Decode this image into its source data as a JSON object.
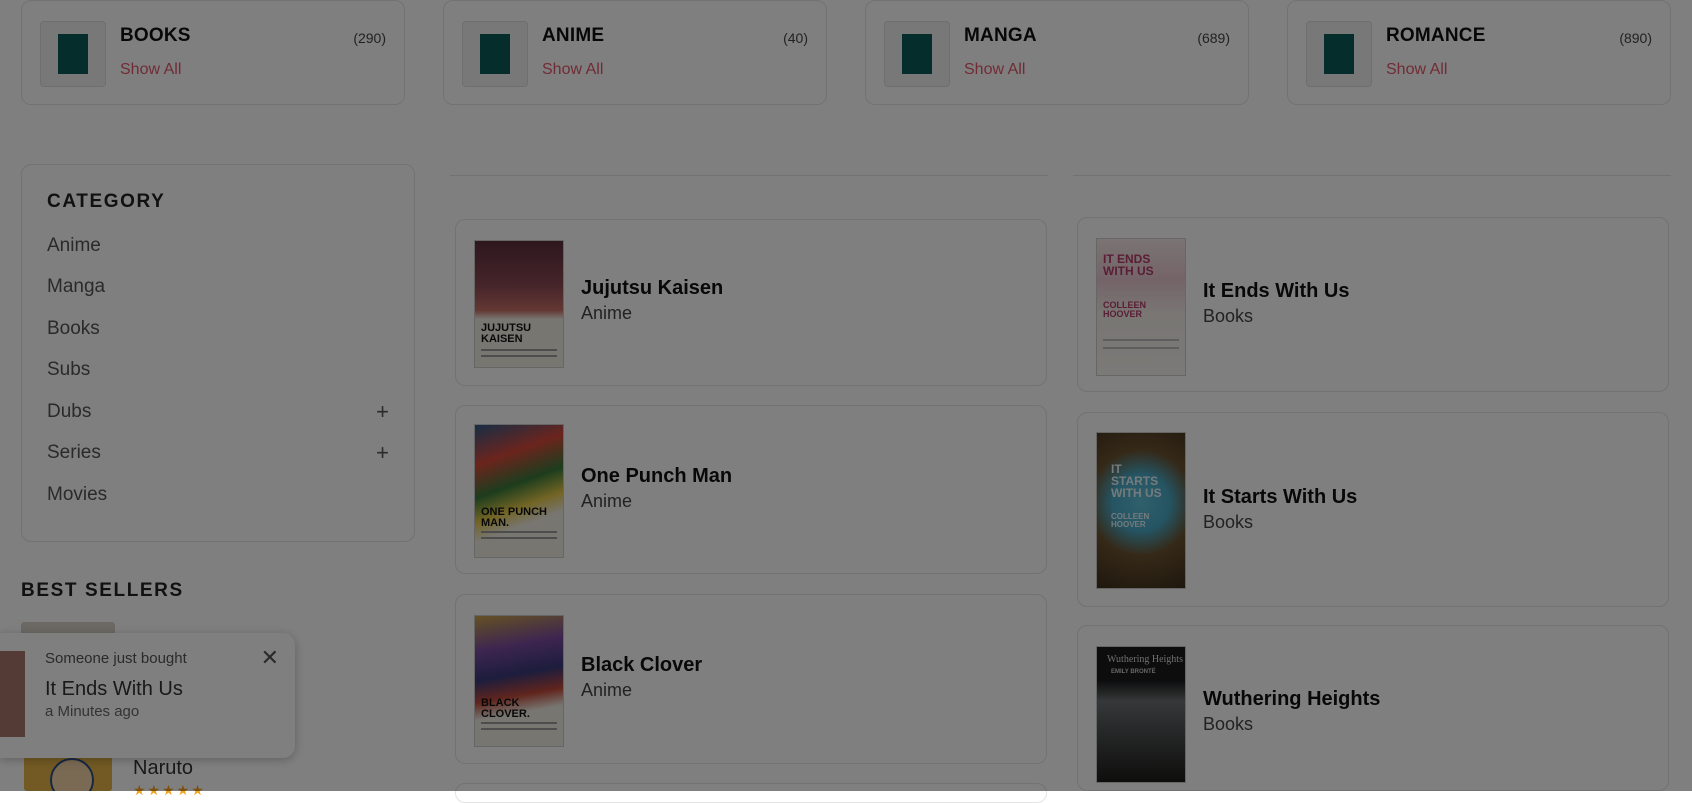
{
  "categories": [
    {
      "name": "BOOKS",
      "count": "(290)",
      "show_all": "Show All"
    },
    {
      "name": "ANIME",
      "count": "(40)",
      "show_all": "Show All"
    },
    {
      "name": "MANGA",
      "count": "(689)",
      "show_all": "Show All"
    },
    {
      "name": "ROMANCE",
      "count": "(890)",
      "show_all": "Show All"
    }
  ],
  "sidebar": {
    "title": "CATEGORY",
    "items": [
      {
        "label": "Anime"
      },
      {
        "label": "Manga"
      },
      {
        "label": "Books"
      },
      {
        "label": "Subs"
      },
      {
        "label": "Dubs",
        "expand": "+"
      },
      {
        "label": "Series",
        "expand": "+"
      },
      {
        "label": "Movies"
      }
    ]
  },
  "best_sellers": {
    "title": "BEST SELLERS",
    "item_name": "Naruto",
    "stars": "★★★★★"
  },
  "left_products": [
    {
      "name": "Jujutsu Kaisen",
      "category": "Anime",
      "cover_text": "JUJUTSU KAISEN"
    },
    {
      "name": "One Punch Man",
      "category": "Anime",
      "cover_text": "ONE PUNCH MAN."
    },
    {
      "name": "Black Clover",
      "category": "Anime",
      "cover_text": "BLACK CLOVER."
    }
  ],
  "right_products": [
    {
      "name": "It Ends With Us",
      "category": "Books",
      "cover_text": "IT ENDS WITH US",
      "cover_author": "COLLEEN HOOVER"
    },
    {
      "name": "It Starts With Us",
      "category": "Books",
      "cover_text": "IT STARTS WITH US",
      "cover_author": "COLLEEN HOOVER"
    },
    {
      "name": "Wuthering Heights",
      "category": "Books",
      "cover_text": "Wuthering Heights",
      "cover_author": "EMILY BRONTË"
    }
  ],
  "toast": {
    "line1": "Someone just bought",
    "product": "It Ends With Us",
    "time": "a Minutes ago",
    "close": "✕"
  },
  "colors": {
    "accent": "#e2576b",
    "star": "#f2a31b",
    "overlay": "rgba(0,0,0,0.5)"
  }
}
